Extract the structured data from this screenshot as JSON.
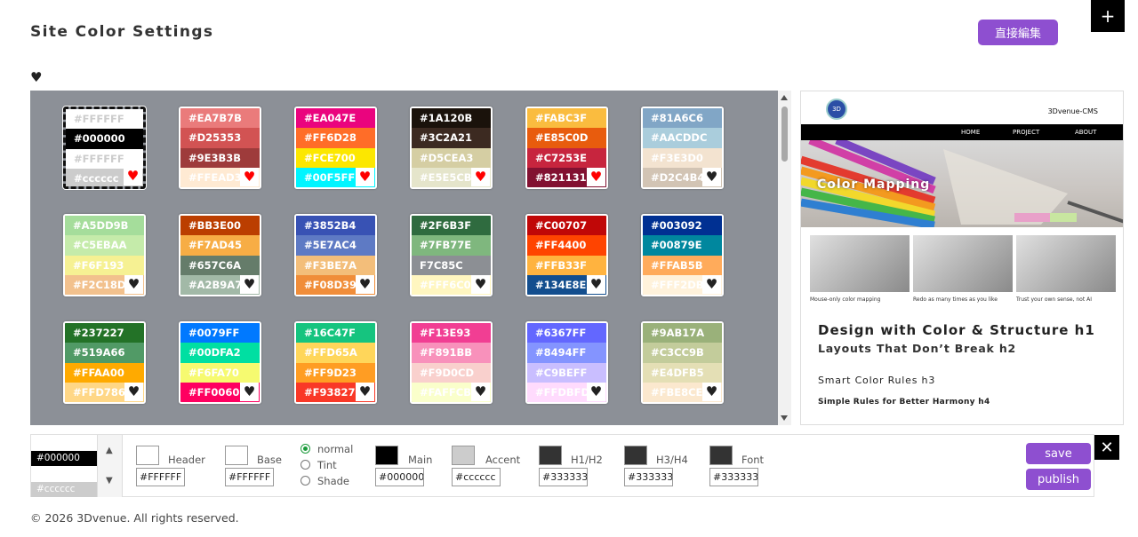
{
  "header": {
    "title": "Site Color Settings",
    "edit_button": "直接編集",
    "plus_button": "+"
  },
  "favorites_icon": "♥",
  "palettes": [
    {
      "colors": [
        "#FFFFFF",
        "#000000",
        "#FFFFFF",
        "#cccccc"
      ],
      "labels": [
        "#FFFFFF",
        "#000000",
        "#FFFFFF",
        "#cccccc"
      ],
      "text": [
        "#cccccc",
        "#ffffff",
        "#cccccc",
        "#ffffff"
      ],
      "fav": true,
      "selected": true
    },
    {
      "colors": [
        "#EA7B7B",
        "#D25353",
        "#9E3B3B",
        "#FFEAD3"
      ],
      "labels": [
        "#EA7B7B",
        "#D25353",
        "#9E3B3B",
        "#FFEAD3"
      ],
      "text": [
        "#fff",
        "#fff",
        "#fff",
        "#fff"
      ],
      "fav": true
    },
    {
      "colors": [
        "#EA047E",
        "#FF6D28",
        "#FCE700",
        "#00F5FF"
      ],
      "labels": [
        "#EA047E",
        "#FF6D28",
        "#FCE700",
        "#00F5FF"
      ],
      "text": [
        "#fff",
        "#fff",
        "#fff",
        "#fff"
      ],
      "fav": true
    },
    {
      "colors": [
        "#1A120B",
        "#3C2A21",
        "#D5CEA3",
        "#E5E5CB"
      ],
      "labels": [
        "#1A120B",
        "#3C2A21",
        "#D5CEA3",
        "#E5E5CB"
      ],
      "text": [
        "#fff",
        "#fff",
        "#fff",
        "#fff"
      ],
      "fav": true
    },
    {
      "colors": [
        "#FABC3F",
        "#E85C0D",
        "#C7253E",
        "#821131"
      ],
      "labels": [
        "#FABC3F",
        "#E85C0D",
        "#C7253E",
        "#821131"
      ],
      "text": [
        "#fff",
        "#fff",
        "#fff",
        "#fff"
      ],
      "fav": true
    },
    {
      "colors": [
        "#81A6C6",
        "#AACDDC",
        "#F3E3D0",
        "#D2C4B4"
      ],
      "labels": [
        "#81A6C6",
        "#AACDDC",
        "#F3E3D0",
        "#D2C4B4"
      ],
      "text": [
        "#fff",
        "#fff",
        "#fff",
        "#fff"
      ],
      "fav": false
    },
    {
      "colors": [
        "#A5DD9B",
        "#C5EBAA",
        "#F6F193",
        "#F2C18D"
      ],
      "labels": [
        "#A5DD9B",
        "#C5EBAA",
        "#F6F193",
        "#F2C18D"
      ],
      "text": [
        "#fff",
        "#fff",
        "#fff",
        "#fff"
      ],
      "fav": false
    },
    {
      "colors": [
        "#BB3E00",
        "#F7AD45",
        "#657C6A",
        "#A2B9A7"
      ],
      "labels": [
        "#BB3E00",
        "#F7AD45",
        "#657C6A",
        "#A2B9A7"
      ],
      "text": [
        "#fff",
        "#fff",
        "#fff",
        "#fff"
      ],
      "fav": false
    },
    {
      "colors": [
        "#3852B4",
        "#5E7AC4",
        "#F3BE7A",
        "#F08D39"
      ],
      "labels": [
        "#3852B4",
        "#5E7AC4",
        "#F3BE7A",
        "#F08D39"
      ],
      "text": [
        "#fff",
        "#fff",
        "#fff",
        "#fff"
      ],
      "fav": false
    },
    {
      "colors": [
        "#2F6B3F",
        "#7FB77E",
        "#8c8f94",
        "#FFF6C0"
      ],
      "labels": [
        "#2F6B3F",
        "#7FB77E",
        "F7C85C",
        "#FFF6C0"
      ],
      "text": [
        "#fff",
        "#fff",
        "#fff",
        "#fff"
      ],
      "fav": false
    },
    {
      "colors": [
        "#C00707",
        "#FF4400",
        "#FFB33F",
        "#134E8E"
      ],
      "labels": [
        "#C00707",
        "#FF4400",
        "#FFB33F",
        "#134E8E"
      ],
      "text": [
        "#fff",
        "#fff",
        "#fff",
        "#fff"
      ],
      "fav": false
    },
    {
      "colors": [
        "#003092",
        "#00879E",
        "#FFAB5B",
        "#FFF2DB"
      ],
      "labels": [
        "#003092",
        "#00879E",
        "#FFAB5B",
        "#FFF2DB"
      ],
      "text": [
        "#fff",
        "#fff",
        "#fff",
        "#fff"
      ],
      "fav": false
    },
    {
      "colors": [
        "#237227",
        "#519A66",
        "#FFAA00",
        "#FFD786"
      ],
      "labels": [
        "#237227",
        "#519A66",
        "#FFAA00",
        "#FFD786"
      ],
      "text": [
        "#fff",
        "#fff",
        "#fff",
        "#fff"
      ],
      "fav": false
    },
    {
      "colors": [
        "#0079FF",
        "#00DFA2",
        "#F6FA70",
        "#FF0060"
      ],
      "labels": [
        "#0079FF",
        "#00DFA2",
        "#F6FA70",
        "#FF0060"
      ],
      "text": [
        "#fff",
        "#fff",
        "#fff",
        "#fff"
      ],
      "fav": false
    },
    {
      "colors": [
        "#16C47F",
        "#FFD65A",
        "#FF9D23",
        "#F93827"
      ],
      "labels": [
        "#16C47F",
        "#FFD65A",
        "#FF9D23",
        "#F93827"
      ],
      "text": [
        "#fff",
        "#fff",
        "#fff",
        "#fff"
      ],
      "fav": false
    },
    {
      "colors": [
        "#F13E93",
        "#F891BB",
        "#F9D0CD",
        "#FAFFCB"
      ],
      "labels": [
        "#F13E93",
        "#F891BB",
        "#F9D0CD",
        "#FAFFCB"
      ],
      "text": [
        "#fff",
        "#fff",
        "#fff",
        "#fff"
      ],
      "fav": false
    },
    {
      "colors": [
        "#6367FF",
        "#8494FF",
        "#C9BEFF",
        "#FFDBFD"
      ],
      "labels": [
        "#6367FF",
        "#8494FF",
        "#C9BEFF",
        "#FFDBFD"
      ],
      "text": [
        "#fff",
        "#fff",
        "#fff",
        "#fff"
      ],
      "fav": false
    },
    {
      "colors": [
        "#9AB17A",
        "#C3CC9B",
        "#E4DFB5",
        "#FBE8CE"
      ],
      "labels": [
        "#9AB17A",
        "#C3CC9B",
        "#E4DFB5",
        "#FBE8CE"
      ],
      "text": [
        "#fff",
        "#fff",
        "#fff",
        "#fff"
      ],
      "fav": false
    }
  ],
  "preview": {
    "logo": "3D",
    "brand": "3Dvenue-CMS",
    "nav": [
      "HOME",
      "PROJECT",
      "ABOUT"
    ],
    "hero_text": "Color Mapping",
    "captions": [
      "Mouse-only color mapping",
      "Redo as many times as you like",
      "Trust your own sense, not AI"
    ],
    "h1": "Design with Color & Structure h1",
    "h2": "Layouts That Don’t Break h2",
    "h3": "Smart Color Rules h3",
    "h4": "Simple Rules for Better Harmony h4"
  },
  "editor": {
    "current": {
      "labels": [
        "",
        "#000000",
        "",
        "#cccccc"
      ],
      "colors": [
        "#FFFFFF",
        "#000000",
        "#FFFFFF",
        "#cccccc"
      ]
    },
    "fields": [
      {
        "label": "Header",
        "value": "#FFFFFF",
        "color": "#FFFFFF"
      },
      {
        "label": "Base",
        "value": "#FFFFFF",
        "color": "#FFFFFF"
      },
      {
        "label": "Main",
        "value": "#000000",
        "color": "#000000"
      },
      {
        "label": "Accent",
        "value": "#cccccc",
        "color": "#cccccc"
      },
      {
        "label": "H1/H2",
        "value": "#333333",
        "color": "#333333"
      },
      {
        "label": "H3/H4",
        "value": "#333333",
        "color": "#333333"
      },
      {
        "label": "Font",
        "value": "#333333",
        "color": "#333333"
      }
    ],
    "modes": [
      {
        "label": "normal",
        "checked": true
      },
      {
        "label": "Tint",
        "checked": false
      },
      {
        "label": "Shade",
        "checked": false
      }
    ],
    "save": "save",
    "publish": "publish",
    "close": "✕"
  },
  "footer": "© 2026 3Dvenue. All rights reserved."
}
